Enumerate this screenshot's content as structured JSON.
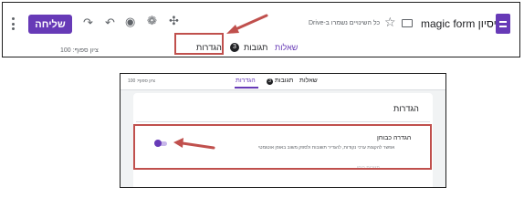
{
  "top_panel": {
    "form_title": "ניסיון magic form",
    "drive_note": "כל השינויים נשמרו ב-Drive",
    "send_button": "שליחה",
    "points_label": "ציון ספוף: 100",
    "tabs": {
      "questions": "שאלות",
      "responses": "תגובות",
      "responses_count": "3",
      "settings": "הגדרות"
    },
    "icons": [
      "forms-logo-icon",
      "folder-icon",
      "star-icon",
      "puzzle-icon",
      "palette-icon",
      "eye-icon",
      "undo-icon",
      "redo-icon",
      "more-vert-icon"
    ]
  },
  "bottom_panel": {
    "points_label": "ציון ספוף: 100",
    "tabs": {
      "questions": "שאלות",
      "responses": "תגובות",
      "responses_count": "3",
      "settings": "הגדרות"
    },
    "settings_heading": "הגדרות",
    "quiz_title": "הגדרה כבוחן",
    "quiz_description": "אפשר להקצות ערכי נקודות, להגדיר תשובות ולספק משוב באופן אוטומטי",
    "faded_text": "תגובות בוחן",
    "toggle_on": true
  },
  "colors": {
    "accent": "#673ab7",
    "highlight": "#c0504d"
  }
}
